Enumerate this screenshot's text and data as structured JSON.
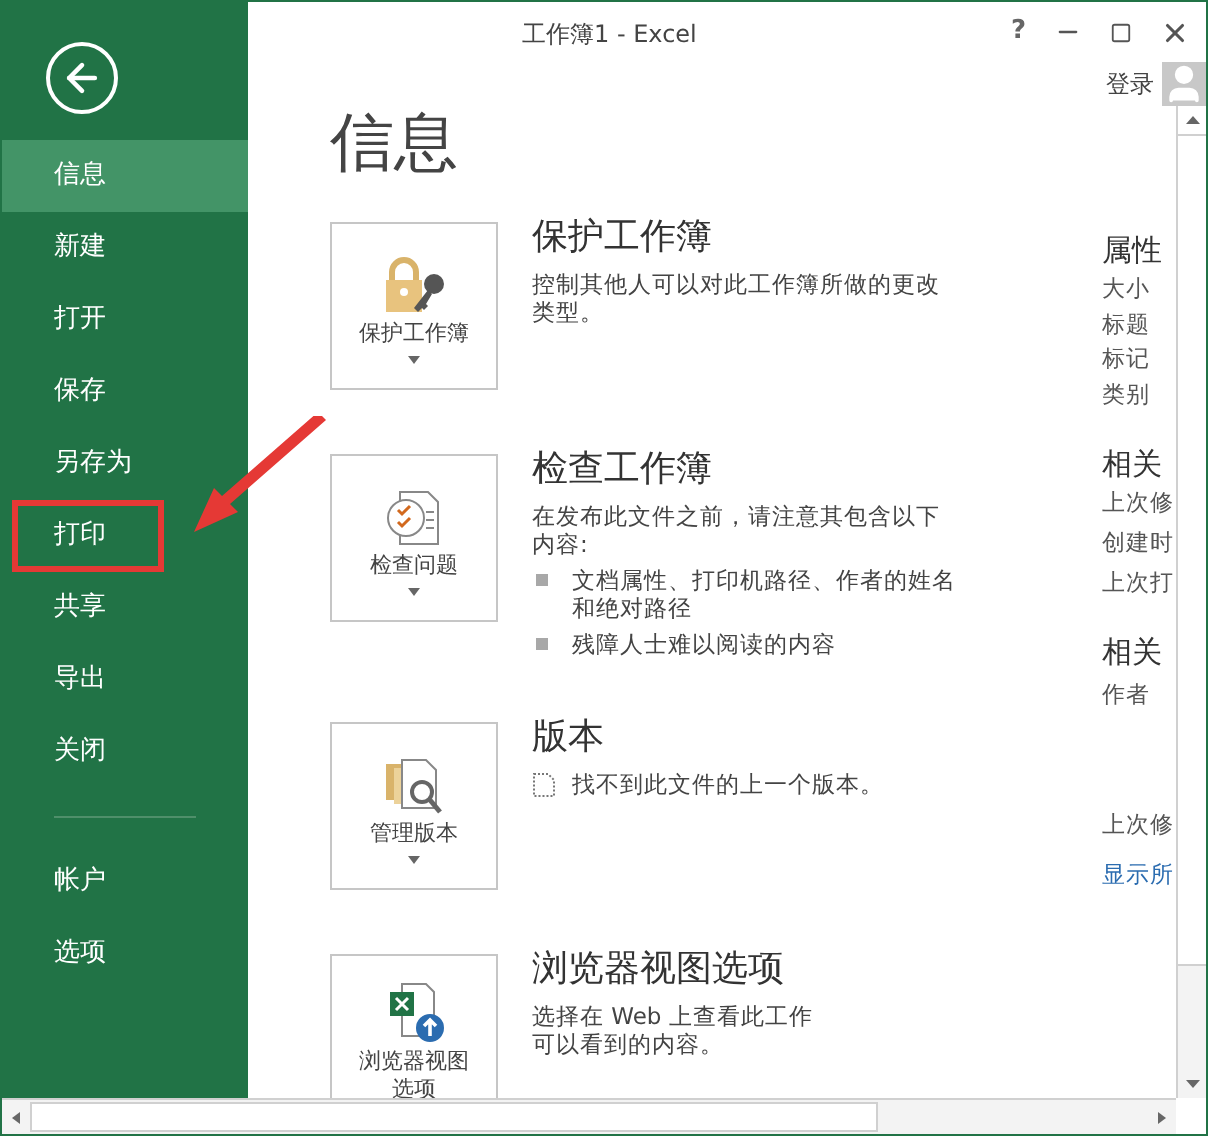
{
  "window": {
    "title": "工作簿1 - Excel",
    "help": "?"
  },
  "account": {
    "sign_in": "登录"
  },
  "sidebar": {
    "items": [
      {
        "label": "信息",
        "selected": true,
        "highlighted": false
      },
      {
        "label": "新建",
        "selected": false,
        "highlighted": false
      },
      {
        "label": "打开",
        "selected": false,
        "highlighted": false
      },
      {
        "label": "保存",
        "selected": false,
        "highlighted": false
      },
      {
        "label": "另存为",
        "selected": false,
        "highlighted": false
      },
      {
        "label": "打印",
        "selected": false,
        "highlighted": true
      },
      {
        "label": "共享",
        "selected": false,
        "highlighted": false
      },
      {
        "label": "导出",
        "selected": false,
        "highlighted": false
      },
      {
        "label": "关闭",
        "selected": false,
        "highlighted": false
      }
    ],
    "footer_items": [
      {
        "label": "帐户",
        "selected": false
      },
      {
        "label": "选项",
        "selected": false
      }
    ]
  },
  "page_title": "信息",
  "sections": [
    {
      "kind": "protect",
      "button_label": "保护工作簿",
      "dropdown": true,
      "title": "保护工作簿",
      "description": "控制其他人可以对此工作簿所做的更改类型。"
    },
    {
      "kind": "inspect",
      "button_label": "检查问题",
      "dropdown": true,
      "title": "检查工作簿",
      "description": "在发布此文件之前，请注意其包含以下内容:",
      "bullets": [
        "文档属性、打印机路径、作者的姓名和绝对路径",
        "残障人士难以阅读的内容"
      ]
    },
    {
      "kind": "versions",
      "button_label": "管理版本",
      "dropdown": true,
      "title": "版本",
      "note": "找不到此文件的上一个版本。"
    },
    {
      "kind": "browser",
      "button_label": "浏览器视图选项",
      "dropdown": false,
      "title": "浏览器视图选项",
      "description": "选择在 Web 上查看此工作",
      "description_2": "可以看到的内容。"
    }
  ],
  "properties": {
    "heading": "属性",
    "labels": [
      "大小",
      "标题",
      "标记",
      "类别"
    ],
    "dates_heading": "相关",
    "date_labels": [
      "上次修",
      "创建时",
      "上次打"
    ],
    "people_heading": "相关",
    "people_labels": [
      "作者"
    ],
    "modified_by": "上次修",
    "link": "显示所"
  }
}
